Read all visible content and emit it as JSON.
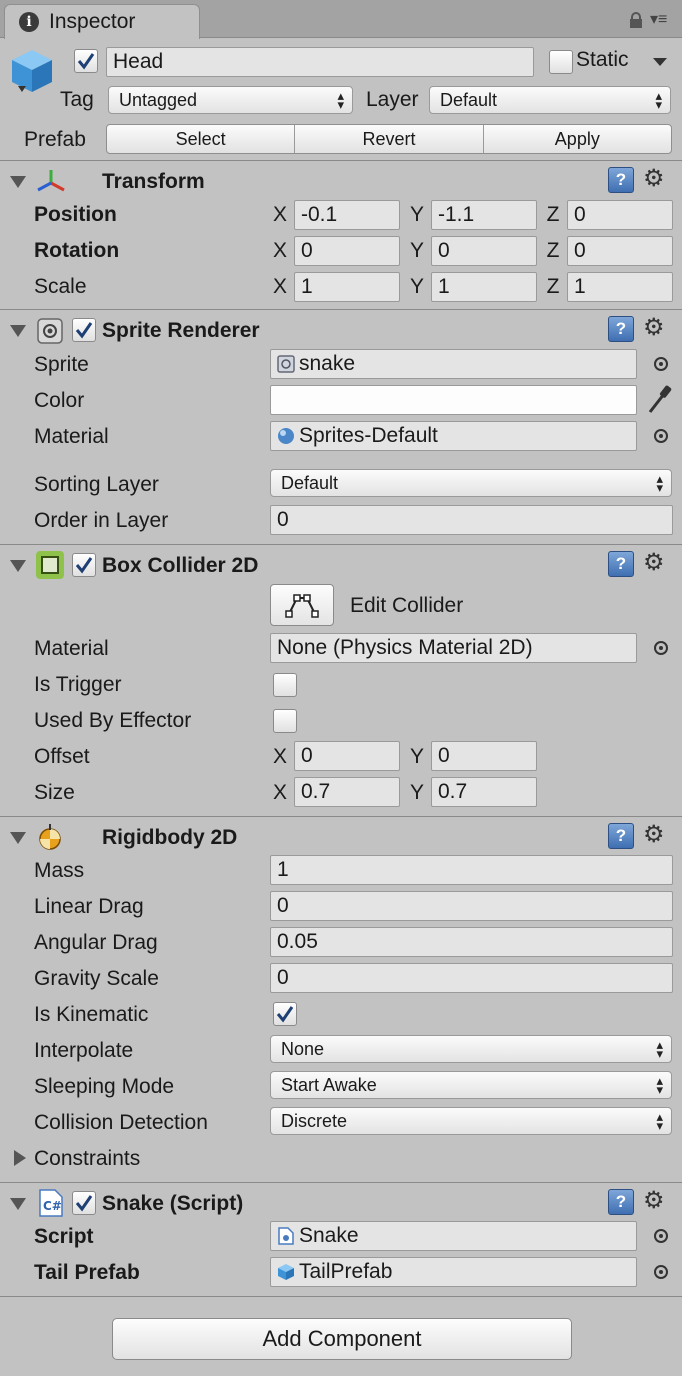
{
  "tab": {
    "title": "Inspector"
  },
  "header": {
    "object_name": "Head",
    "active": true,
    "static_label": "Static",
    "static_checked": false,
    "tag_label": "Tag",
    "tag_value": "Untagged",
    "layer_label": "Layer",
    "layer_value": "Default",
    "prefab_label": "Prefab",
    "prefab_buttons": [
      "Select",
      "Revert",
      "Apply"
    ]
  },
  "transform": {
    "title": "Transform",
    "rows": [
      {
        "label": "Position",
        "x": "-0.1",
        "y": "-1.1",
        "z": "0"
      },
      {
        "label": "Rotation",
        "x": "0",
        "y": "0",
        "z": "0"
      },
      {
        "label": "Scale",
        "x": "1",
        "y": "1",
        "z": "1"
      }
    ]
  },
  "sprite_renderer": {
    "title": "Sprite Renderer",
    "enabled": true,
    "sprite_label": "Sprite",
    "sprite_value": "snake",
    "color_label": "Color",
    "material_label": "Material",
    "material_value": "Sprites-Default",
    "sorting_layer_label": "Sorting Layer",
    "sorting_layer_value": "Default",
    "order_label": "Order in Layer",
    "order_value": "0"
  },
  "box_collider": {
    "title": "Box Collider 2D",
    "enabled": true,
    "edit_collider_label": "Edit Collider",
    "material_label": "Material",
    "material_value": "None (Physics Material 2D)",
    "is_trigger_label": "Is Trigger",
    "is_trigger": false,
    "used_by_effector_label": "Used By Effector",
    "used_by_effector": false,
    "offset_label": "Offset",
    "offset_x": "0",
    "offset_y": "0",
    "size_label": "Size",
    "size_x": "0.7",
    "size_y": "0.7"
  },
  "rigidbody": {
    "title": "Rigidbody 2D",
    "mass_label": "Mass",
    "mass": "1",
    "linear_drag_label": "Linear Drag",
    "linear_drag": "0",
    "angular_drag_label": "Angular Drag",
    "angular_drag": "0.05",
    "gravity_label": "Gravity Scale",
    "gravity": "0",
    "kinematic_label": "Is Kinematic",
    "kinematic": true,
    "interpolate_label": "Interpolate",
    "interpolate": "None",
    "sleeping_label": "Sleeping Mode",
    "sleeping": "Start Awake",
    "collision_label": "Collision Detection",
    "collision": "Discrete",
    "constraints_label": "Constraints"
  },
  "script": {
    "title": "Snake (Script)",
    "enabled": true,
    "script_label": "Script",
    "script_value": "Snake",
    "tail_label": "Tail Prefab",
    "tail_value": "TailPrefab"
  },
  "add_component_label": "Add Component",
  "axis_labels": {
    "x": "X",
    "y": "Y",
    "z": "Z"
  },
  "colors": {
    "panel_bg": "#c2c2c2",
    "field_bg": "#e4e4e4",
    "help_blue": "#3f6fb2",
    "cube_blue": "#4aa3e6"
  }
}
